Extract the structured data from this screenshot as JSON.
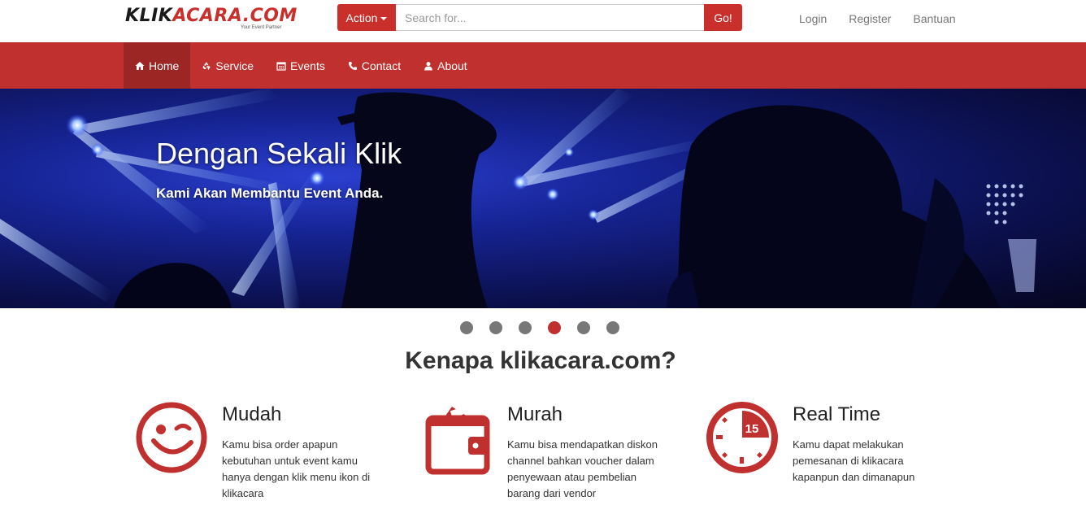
{
  "brand": {
    "logo_part1": "KLIK",
    "logo_part2": "ACARA.COM",
    "tagline": "Your Event Partner"
  },
  "search": {
    "action_label": "Action",
    "placeholder": "Search for...",
    "go_label": "Go!"
  },
  "top_links": [
    "Login",
    "Register",
    "Bantuan"
  ],
  "nav": [
    {
      "label": "Home",
      "icon": "home-icon",
      "active": true
    },
    {
      "label": "Service",
      "icon": "recycle-icon"
    },
    {
      "label": "Events",
      "icon": "calendar-icon"
    },
    {
      "label": "Contact",
      "icon": "phone-icon"
    },
    {
      "label": "About",
      "icon": "user-icon"
    }
  ],
  "hero": {
    "title": "Dengan Sekali Klik",
    "subtitle": "Kami Akan Membantu Event Anda."
  },
  "carousel": {
    "count": 6,
    "active_index": 3
  },
  "section": {
    "title": "Kenapa klikacara.com?"
  },
  "features": [
    {
      "title": "Mudah",
      "icon": "smiley-wink-icon",
      "description": "Kamu bisa order apapun kebutuhan untuk event kamu hanya dengan klik menu ikon di klikacara"
    },
    {
      "title": "Murah",
      "icon": "wallet-icon",
      "description": "Kamu bisa mendapatkan diskon channel bahkan voucher dalam penyewaan atau pembelian barang dari vendor"
    },
    {
      "title": "Real Time",
      "icon": "clock-15-icon",
      "description": "Kamu dapat melakukan pemesanan di klikacara kapanpun dan dimanapun"
    }
  ],
  "colors": {
    "accent": "#c0302e",
    "nav_active": "#9c2624",
    "dot": "#777777"
  }
}
